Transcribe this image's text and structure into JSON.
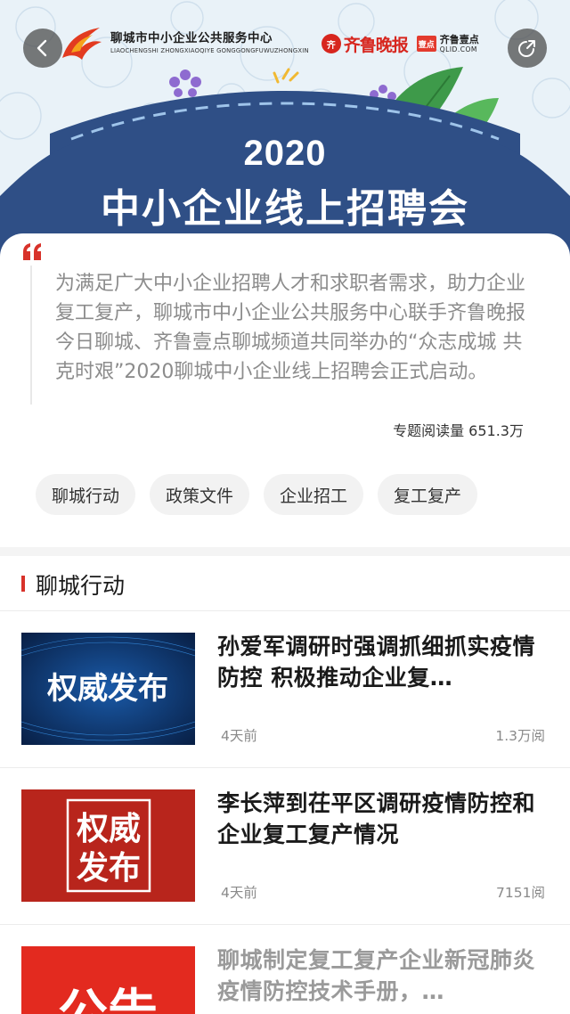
{
  "header": {
    "back_icon": "chevron-left-icon",
    "share_icon": "share-icon",
    "org_name_cn": "聊城市中小企业公共服务中心",
    "org_name_en": "LIAOCHENGSHI ZHONGXIAOQIYE GONGGONGFUWUZHONGXIN",
    "paper_logo": "齐鲁晚报",
    "paper_badge": "齐",
    "qlid_badge": "壹点",
    "qlid_cn": "齐鲁壹点",
    "qlid_en": "QLID.COM"
  },
  "banner": {
    "year": "2020",
    "title": "中小企业线上招聘会"
  },
  "intro": {
    "quote_icon": "quote-icon",
    "text": "为满足广大中小企业招聘人才和求职者需求，助力企业复工复产，聊城市中小企业公共服务中心联手齐鲁晚报今日聊城、齐鲁壹点聊城频道共同举办的“众志成城 共克时艰”2020聊城中小企业线上招聘会正式启动。",
    "read_count": "专题阅读量 651.3万"
  },
  "tags": [
    "聊城行动",
    "政策文件",
    "企业招工",
    "复工复产"
  ],
  "section": {
    "title": "聊城行动"
  },
  "news": [
    {
      "title": "孙爱军调研时强调抓细抓实疫情防控 积极推动企业复…",
      "thumb_text": "权威发布",
      "time": "4天前",
      "views": "1.3万阅"
    },
    {
      "title": "李长萍到茌平区调研疫情防控和企业复工复产情况",
      "thumb_text_1": "权威",
      "thumb_text_2": "发布",
      "time": "4天前",
      "views": "7151阅"
    },
    {
      "title": "聊城制定复工复产企业新冠肺炎疫情防控技术手册，…",
      "thumb_text": "公告"
    }
  ],
  "colors": {
    "accent_red": "#d8322a",
    "banner_navy": "#2f4f86",
    "banner_bg": "#e9f2f8",
    "thumb_blue": "#0c2f63",
    "thumb_red": "#b8251c"
  }
}
